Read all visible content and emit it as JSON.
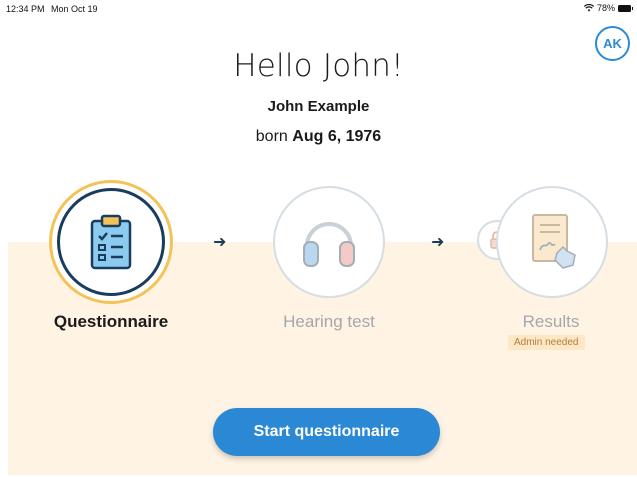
{
  "status_bar": {
    "time": "12:34 PM",
    "date": "Mon Oct 19",
    "battery": "78%"
  },
  "avatar": {
    "initials": "AK",
    "color": "#2b8ad6"
  },
  "header": {
    "greeting": "Hello John!",
    "name": "John Example",
    "born_prefix": "born",
    "born_date": "Aug 6, 1976"
  },
  "steps": [
    {
      "label": "Questionnaire",
      "icon": "clipboard-checklist-icon",
      "state": "active"
    },
    {
      "label": "Hearing test",
      "icon": "headphones-icon",
      "state": "disabled"
    },
    {
      "label": "Results",
      "icon": "signed-document-icon",
      "state": "locked",
      "badge": "Admin needed",
      "lock_icon": "lock-icon"
    }
  ],
  "arrows": [
    "arrow-right-icon",
    "arrow-right-icon"
  ],
  "action": {
    "start_label": "Start questionnaire"
  },
  "colors": {
    "accent": "#2b88d4",
    "active_ring": "#f3c35a",
    "navy": "#1b3d5d",
    "band": "#fff3e3",
    "disabled_text": "#a3a8ad",
    "badge_bg": "#fde7c5"
  }
}
